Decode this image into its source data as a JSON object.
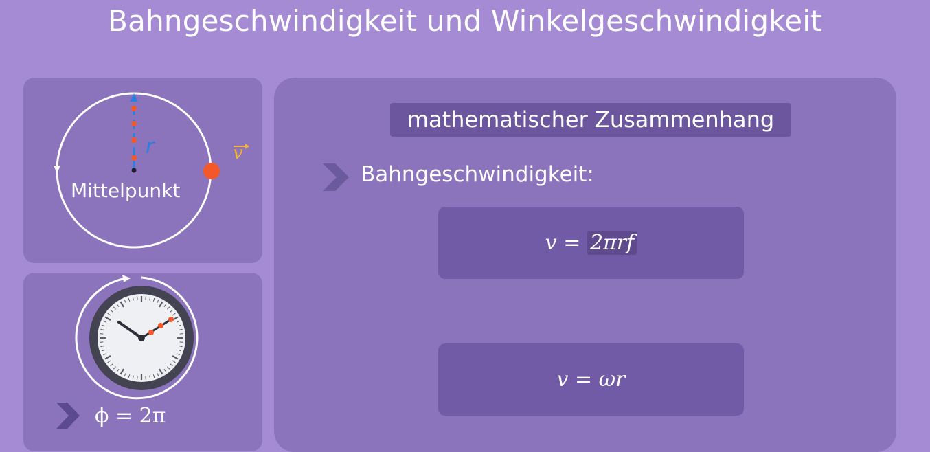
{
  "title": "Bahngeschwindigkeit und Winkelgeschwindigkeit",
  "left_top_panel": {
    "center_label": "Mittelpunkt",
    "radius_label": "r",
    "velocity_label": "v"
  },
  "left_bottom_panel": {
    "angle_label": "ϕ = 2π"
  },
  "main_panel": {
    "section_heading": "mathematischer Zusammenhang",
    "bullet_label": "Bahngeschwindigkeit:",
    "formula1": {
      "lhs": "v = ",
      "highlighted": "2πrf"
    },
    "formula2": "v = ωr"
  },
  "colors": {
    "background": "#a58bd3",
    "panel": "#8c74bd",
    "formula_box": "#725ba6",
    "radius_blue": "#2b7fe0",
    "dot_orange": "#f3582a",
    "vector_yellow": "#f2b533"
  }
}
